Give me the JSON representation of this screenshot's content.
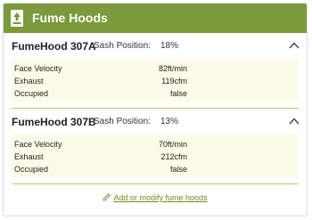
{
  "header": {
    "title": "Fume Hoods",
    "icon": "upload-tray-icon",
    "color": "#7a9a3c"
  },
  "hoods": [
    {
      "name": "FumeHood 307A",
      "sash_label": "Sash Position:",
      "sash_value": "18%",
      "expanded": true,
      "rows": [
        {
          "label": "Face Velocity",
          "value": "82ft/min"
        },
        {
          "label": "Exhaust",
          "value": "119cfm"
        },
        {
          "label": "Occupied",
          "value": "false"
        }
      ]
    },
    {
      "name": "FumeHood 307B",
      "sash_label": "Sash Position:",
      "sash_value": "13%",
      "expanded": true,
      "rows": [
        {
          "label": "Face Velocity",
          "value": "70ft/min"
        },
        {
          "label": "Exhaust",
          "value": "212cfm"
        },
        {
          "label": "Occupied",
          "value": "false"
        }
      ]
    }
  ],
  "footer": {
    "link_label": "Add or modify fume hoods",
    "icon": "pencil-icon",
    "link_color": "#6b8e23"
  }
}
